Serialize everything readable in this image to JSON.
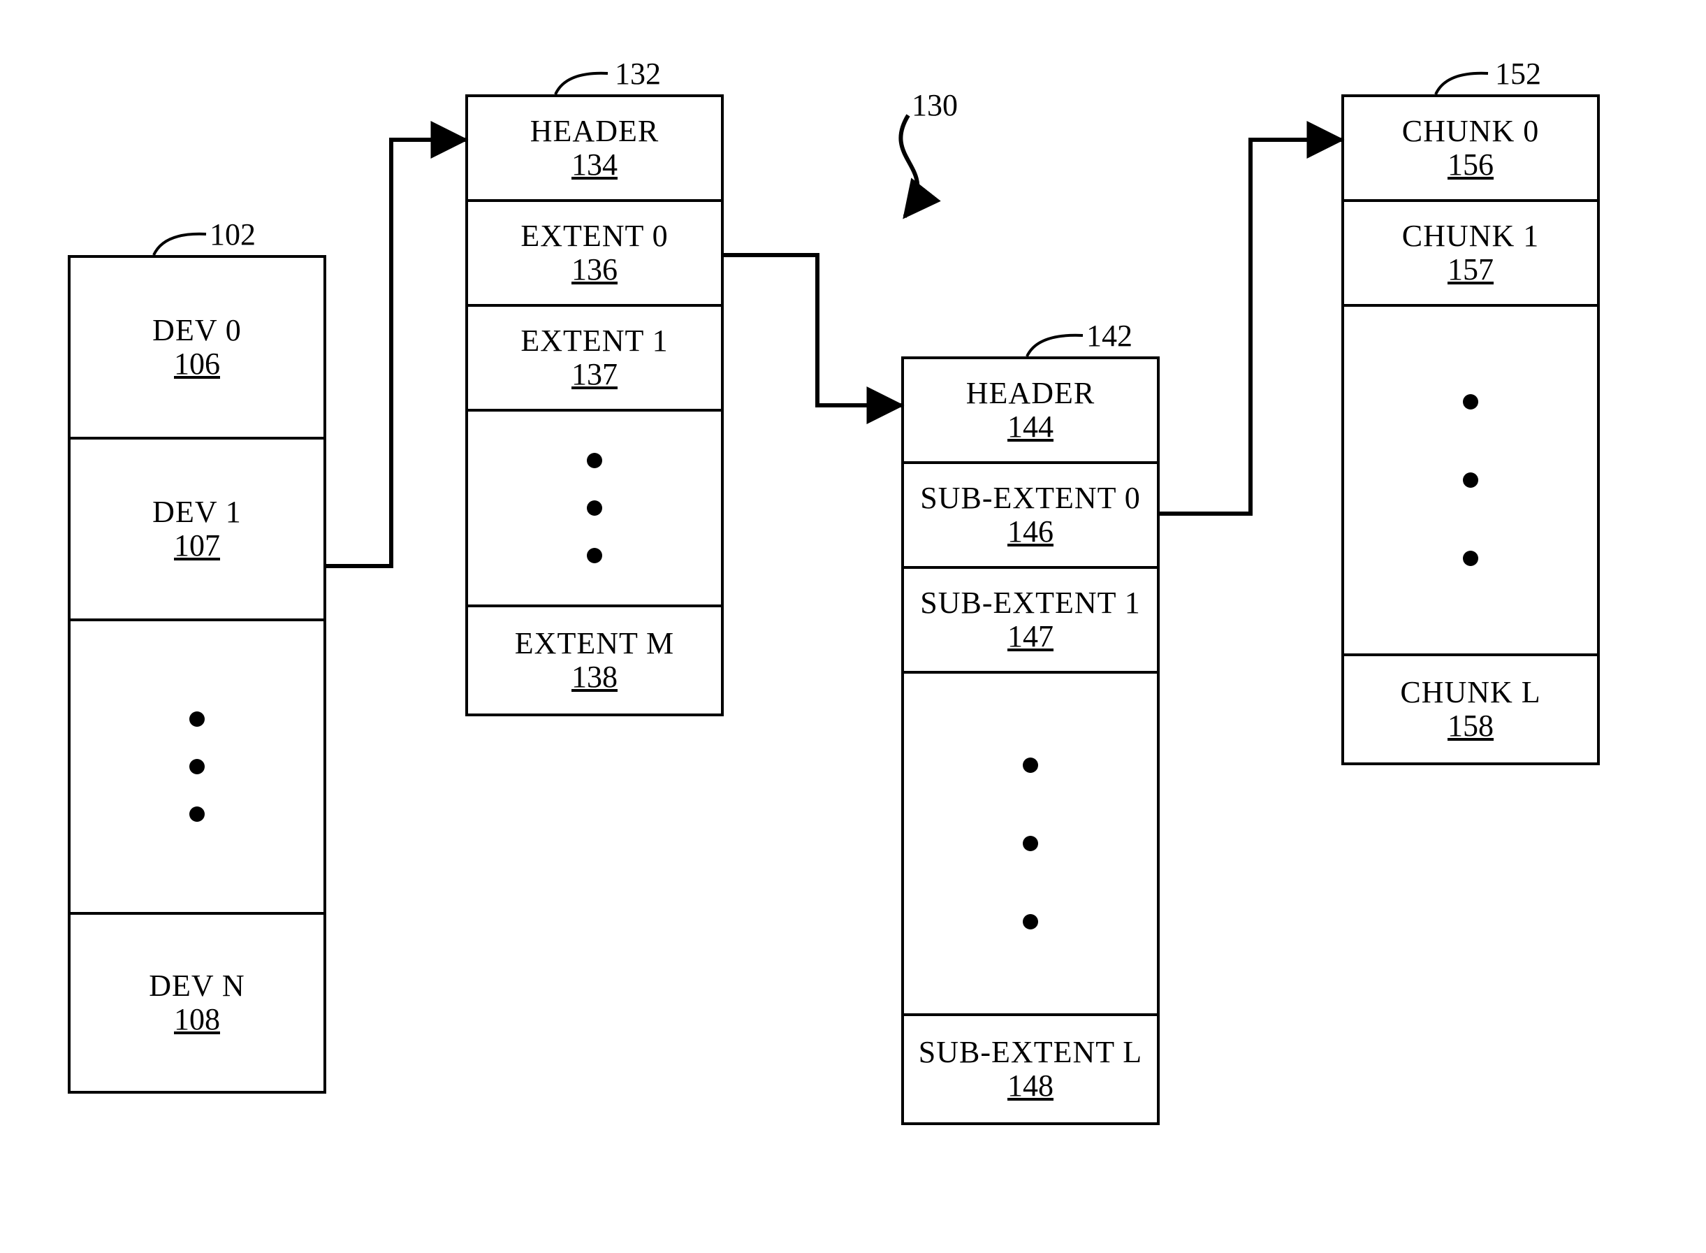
{
  "figure_tag": {
    "text": "130"
  },
  "boxes": {
    "dev": {
      "tag": "102",
      "cells": [
        {
          "name": "DEV 0",
          "ref": "106"
        },
        {
          "name": "DEV 1",
          "ref": "107"
        },
        {
          "name": "DEV N",
          "ref": "108"
        }
      ]
    },
    "extent": {
      "tag": "132",
      "cells": [
        {
          "name": "HEADER",
          "ref": "134"
        },
        {
          "name": "EXTENT 0",
          "ref": "136"
        },
        {
          "name": "EXTENT 1",
          "ref": "137"
        },
        {
          "name": "EXTENT M",
          "ref": "138"
        }
      ]
    },
    "subextent": {
      "tag": "142",
      "cells": [
        {
          "name": "HEADER",
          "ref": "144"
        },
        {
          "name": "SUB-EXTENT 0",
          "ref": "146"
        },
        {
          "name": "SUB-EXTENT 1",
          "ref": "147"
        },
        {
          "name": "SUB-EXTENT L",
          "ref": "148"
        }
      ]
    },
    "chunk": {
      "tag": "152",
      "cells": [
        {
          "name": "CHUNK 0",
          "ref": "156"
        },
        {
          "name": "CHUNK 1",
          "ref": "157"
        },
        {
          "name": "CHUNK L",
          "ref": "158"
        }
      ]
    }
  }
}
